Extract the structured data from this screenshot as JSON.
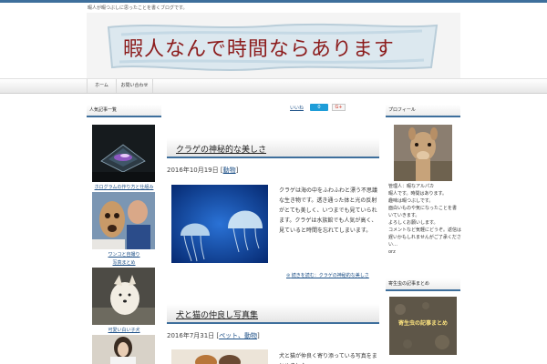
{
  "site": {
    "tagline": "暇人が暇つぶしに思ったことを書くブログです。",
    "title": "暇人なんで時間ならあります"
  },
  "nav": {
    "items": [
      {
        "label": "ホーム"
      },
      {
        "label": "お問い合わせ"
      }
    ]
  },
  "left_sidebar": {
    "widget_title": "人気記事一覧",
    "articles": [
      {
        "title": "ホログラムの作り方と仕組み"
      },
      {
        "title_line1": "ワンコと自撮り",
        "title_line2": "写真まとめ"
      },
      {
        "title": "可愛い白い子犬"
      },
      {
        "title": ""
      }
    ]
  },
  "share": {
    "like_label": "いいね",
    "count": "0",
    "gplus_label": "G+"
  },
  "posts": [
    {
      "title": "クラゲの神秘的な美しさ",
      "date": "2016年10月19日",
      "category": "動物",
      "excerpt": "クラゲは海の中をふわふわと漂う不思議な生き物です。透き通った体と光の反射がとても美しく、いつまでも見ていられます。クラゲは水族館でも人気が高く、見ていると時間を忘れてしまいます。",
      "more": "続きを読む：クラゲの神秘的な美しさ"
    },
    {
      "title": "犬と猫の仲良し写真集",
      "date": "2016年7月31日",
      "category": "ペット、動物",
      "excerpt": "犬と猫が仲良く寄り添っている写真をまとめました。",
      "more": ""
    }
  ],
  "right_sidebar": {
    "profile_title": "プロフィール",
    "profile_lines": [
      "管理人：暇なアルパカ",
      "暇人です。時間はあります。",
      "趣味は暇つぶしです。",
      "面白いものや気になったことを書いていきます。",
      "よろしくお願いします。",
      "コメントなど気軽にどうぞ。返信は遅いかもしれませんがご了承ください…",
      "orz"
    ],
    "widget2_title": "寄生虫の記事まとめ",
    "widget2_image_text": "寄生虫の記事まとめ"
  }
}
